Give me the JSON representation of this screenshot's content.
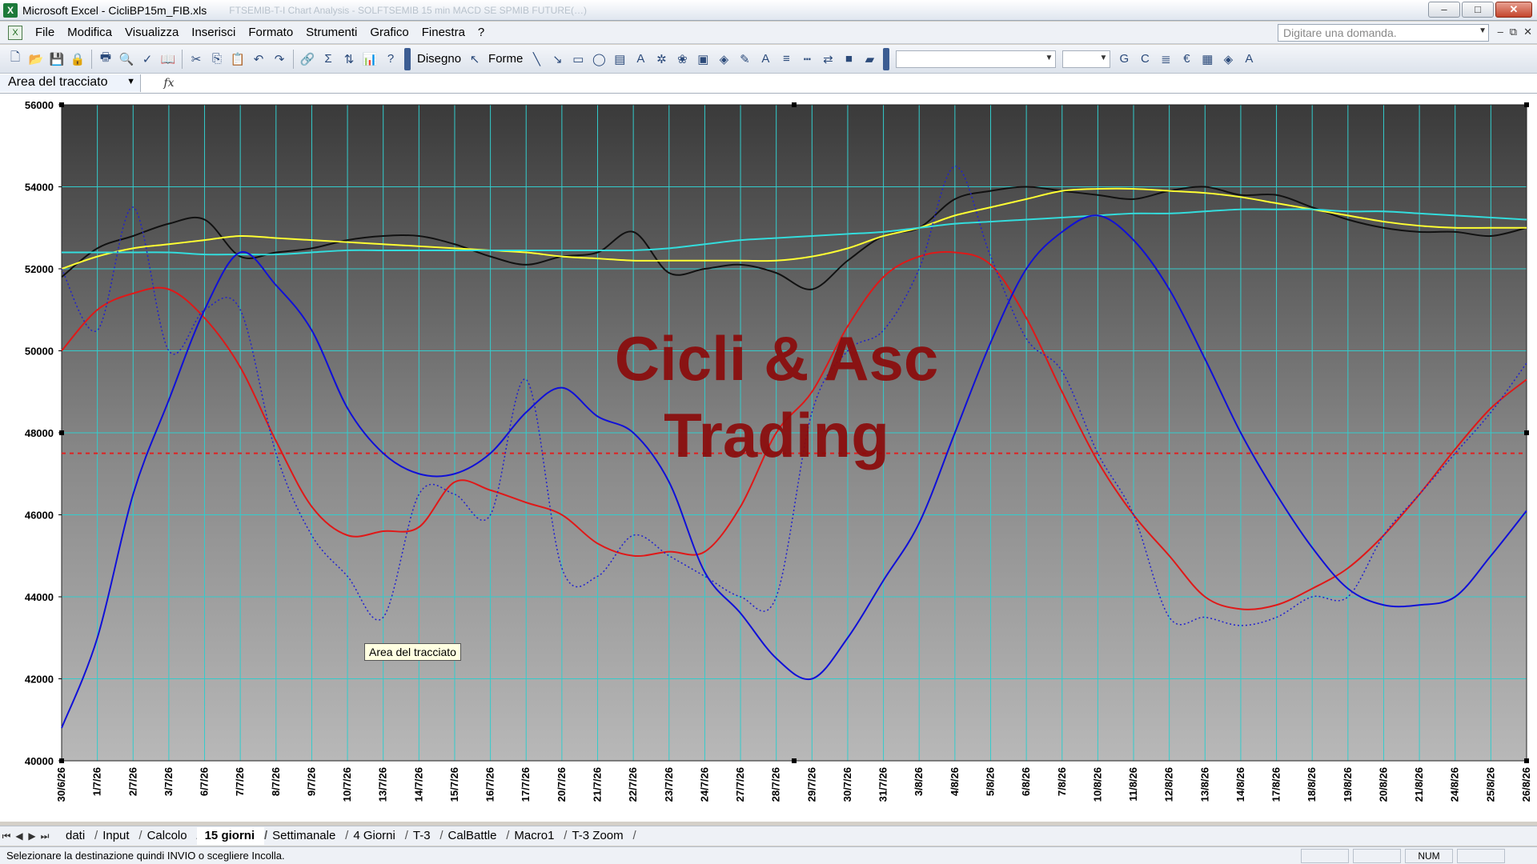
{
  "window": {
    "title": "Microsoft Excel - CicliBP15m_FIB.xls",
    "ghost_text": "FTSEMIB-T-I    Chart Analysis - SOLFTSEMIB  15 min   MACD SE SPMIB FUTURE(…)",
    "minimize": "–",
    "maximize": "□",
    "close": "✕"
  },
  "menu": {
    "items": [
      "File",
      "Modifica",
      "Visualizza",
      "Inserisci",
      "Formato",
      "Strumenti",
      "Grafico",
      "Finestra",
      "?"
    ],
    "ask_placeholder": "Digitare una domanda.",
    "right_controls": [
      "–",
      "⧉",
      "✕"
    ]
  },
  "toolbar": {
    "disegno_label": "Disegno",
    "forme_label": "Forme",
    "font_combo_value": "",
    "size_combo_value": ""
  },
  "formula_bar": {
    "name_box": "Area del tracciato",
    "fx": "fx"
  },
  "chart": {
    "watermark_line1": "Cicli & Asc",
    "watermark_line2": "Trading",
    "tooltip": "Area del tracciato"
  },
  "chart_data": {
    "type": "line",
    "title": "",
    "xlabel": "",
    "ylabel": "",
    "ylim": [
      40000,
      56000
    ],
    "yticks": [
      "56000",
      "54000",
      "52000",
      "50000",
      "48000",
      "46000",
      "44000",
      "42000",
      "40000"
    ],
    "x": [
      "30/6/26",
      "1/7/26",
      "2/7/26",
      "3/7/26",
      "6/7/26",
      "7/7/26",
      "8/7/26",
      "9/7/26",
      "10/7/26",
      "13/7/26",
      "14/7/26",
      "15/7/26",
      "16/7/26",
      "17/7/26",
      "20/7/26",
      "21/7/26",
      "22/7/26",
      "23/7/26",
      "24/7/26",
      "27/7/26",
      "28/7/26",
      "29/7/26",
      "30/7/26",
      "31/7/26",
      "3/8/26",
      "4/8/26",
      "5/8/26",
      "6/8/26",
      "7/8/26",
      "10/8/26",
      "11/8/26",
      "12/8/26",
      "13/8/26",
      "14/8/26",
      "17/8/26",
      "18/8/26",
      "19/8/26",
      "20/8/26",
      "21/8/26",
      "24/8/26",
      "25/8/26",
      "26/8/26"
    ],
    "horizontal_line": {
      "value": 47500,
      "color": "#e02020",
      "style": "dashed"
    },
    "grid": true,
    "series": [
      {
        "color": "#111111",
        "style": "solid",
        "values": [
          51800,
          52500,
          52800,
          53100,
          53200,
          52300,
          52400,
          52500,
          52700,
          52800,
          52800,
          52600,
          52300,
          52100,
          52300,
          52400,
          52900,
          51900,
          52000,
          52100,
          51900,
          51500,
          52200,
          52800,
          53000,
          53700,
          53900,
          54000,
          53900,
          53800,
          53700,
          53900,
          54000,
          53800,
          53800,
          53500,
          53200,
          53000,
          52900,
          52900,
          52800,
          53000
        ]
      },
      {
        "color": "#ffff33",
        "style": "solid",
        "values": [
          52000,
          52300,
          52500,
          52600,
          52700,
          52800,
          52750,
          52700,
          52650,
          52600,
          52550,
          52500,
          52450,
          52400,
          52300,
          52250,
          52200,
          52200,
          52200,
          52200,
          52200,
          52300,
          52500,
          52800,
          53000,
          53300,
          53500,
          53700,
          53900,
          53950,
          53950,
          53900,
          53850,
          53750,
          53600,
          53450,
          53300,
          53150,
          53050,
          53000,
          53000,
          53000
        ]
      },
      {
        "color": "#33dddd",
        "style": "solid",
        "values": [
          52400,
          52400,
          52400,
          52400,
          52350,
          52350,
          52350,
          52400,
          52450,
          52450,
          52450,
          52450,
          52450,
          52450,
          52450,
          52450,
          52450,
          52500,
          52600,
          52700,
          52750,
          52800,
          52850,
          52900,
          53000,
          53100,
          53150,
          53200,
          53250,
          53300,
          53350,
          53350,
          53400,
          53450,
          53450,
          53450,
          53400,
          53400,
          53350,
          53300,
          53250,
          53200
        ]
      },
      {
        "color": "#e01818",
        "style": "solid",
        "values": [
          50000,
          51000,
          51400,
          51500,
          50800,
          49600,
          47800,
          46200,
          45500,
          45600,
          45700,
          46800,
          46600,
          46300,
          46000,
          45300,
          45000,
          45100,
          45100,
          46200,
          48000,
          49000,
          50600,
          51800,
          52300,
          52400,
          52100,
          50800,
          49000,
          47300,
          46000,
          45000,
          44000,
          43700,
          43800,
          44200,
          44700,
          45500,
          46500,
          47600,
          48600,
          49300
        ]
      },
      {
        "color": "#1010d8",
        "style": "solid",
        "values": [
          40800,
          43000,
          46500,
          48800,
          51000,
          52400,
          51600,
          50500,
          48600,
          47500,
          47000,
          47000,
          47500,
          48500,
          49100,
          48400,
          48000,
          46800,
          44600,
          43600,
          42500,
          42000,
          43000,
          44400,
          45800,
          48000,
          50200,
          52000,
          52900,
          53300,
          52700,
          51500,
          49800,
          48000,
          46500,
          45200,
          44200,
          43800,
          43800,
          44000,
          45000,
          46100
        ]
      },
      {
        "color": "#2020d0",
        "style": "dotted",
        "values": [
          52000,
          50500,
          53500,
          50000,
          51000,
          51000,
          47500,
          45500,
          44500,
          43500,
          46500,
          46500,
          46000,
          49300,
          44700,
          44500,
          45500,
          45000,
          44500,
          44000,
          44000,
          48500,
          50000,
          50500,
          52000,
          54500,
          52300,
          50300,
          49500,
          47500,
          46000,
          43500,
          43500,
          43300,
          43500,
          44000,
          44000,
          45500,
          46500,
          47500,
          48500,
          49700
        ]
      }
    ]
  },
  "sheet_tabs": {
    "nav": [
      "⏮",
      "◀",
      "▶",
      "⏭"
    ],
    "items": [
      "dati",
      "Input",
      "Calcolo",
      "15 giorni",
      "Settimanale",
      "4 Giorni",
      "T-3",
      "CalBattle",
      "Macro1",
      "T-3 Zoom"
    ],
    "active": "15 giorni"
  },
  "status": {
    "message": "Selezionare la destinazione quindi INVIO o scegliere Incolla.",
    "num": "NUM"
  }
}
